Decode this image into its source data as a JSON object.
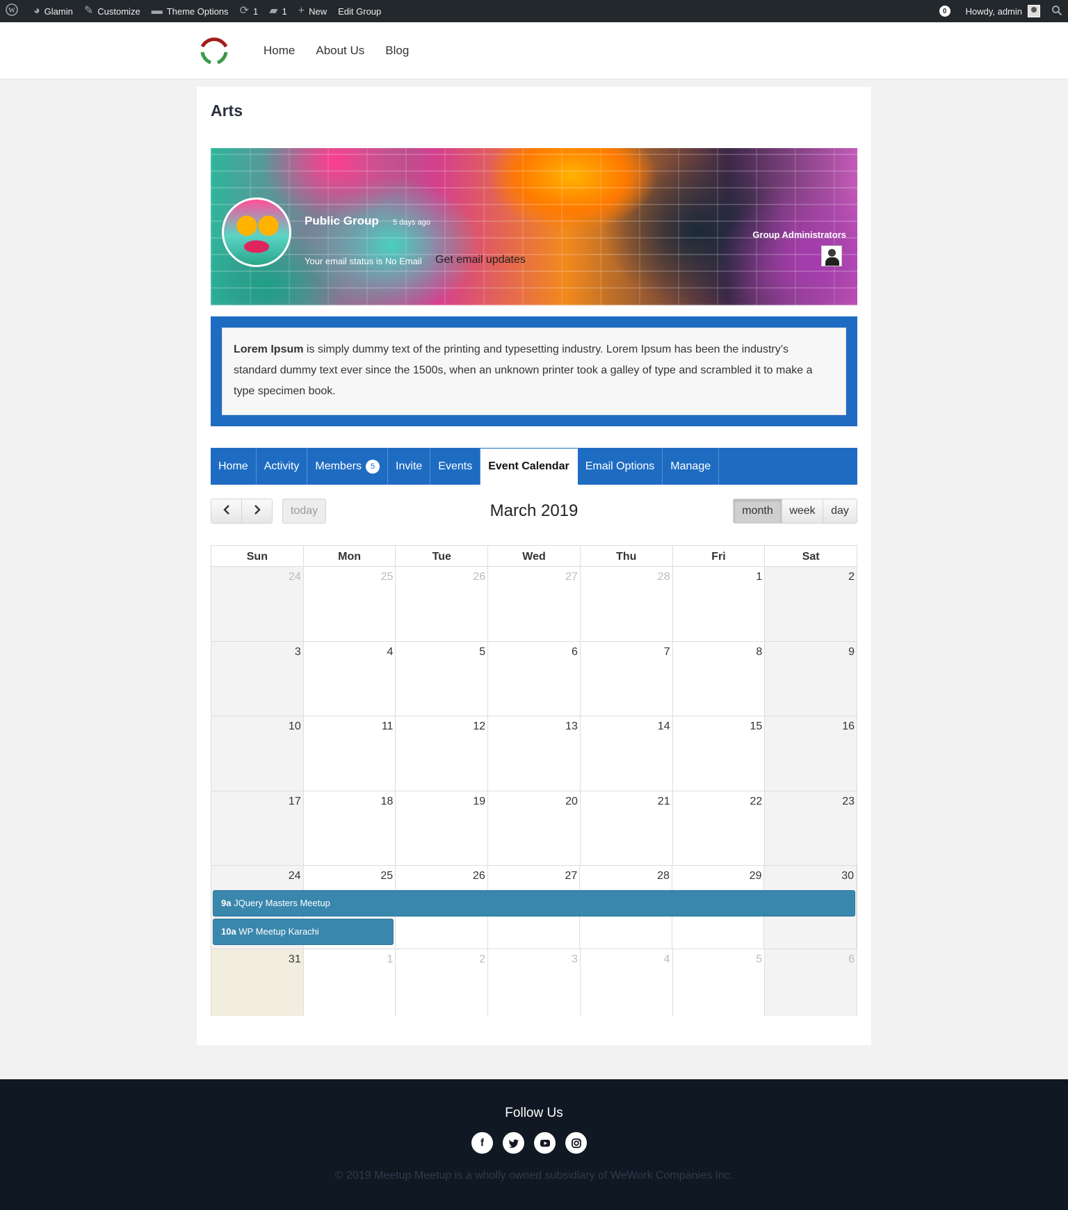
{
  "adminbar": {
    "site_name": "Glamin",
    "customize": "Customize",
    "theme_options": "Theme Options",
    "updates_count": "1",
    "comments_count": "1",
    "new": "New",
    "edit_group": "Edit Group",
    "notifications": "0",
    "howdy": "Howdy, admin"
  },
  "nav": {
    "items": [
      "Home",
      "About Us",
      "Blog"
    ]
  },
  "page": {
    "title": "Arts"
  },
  "group": {
    "type": "Public Group",
    "active": "5 days ago",
    "email_status": "Your email status is No Email",
    "email_button": "Get email updates",
    "admins_label": "Group Administrators",
    "description_bold": "Lorem Ipsum",
    "description_rest": " is simply dummy text of the printing and typesetting industry. Lorem Ipsum has been the industry’s standard dummy text ever since the 1500s, when an unknown printer took a galley of type and scrambled it to make a type specimen book."
  },
  "tabs": {
    "home": "Home",
    "activity": "Activity",
    "members": "Members",
    "members_count": "5",
    "invite": "Invite",
    "events": "Events",
    "event_calendar": "Event Calendar",
    "email_options": "Email Options",
    "manage": "Manage"
  },
  "calendar": {
    "title": "March 2019",
    "today_label": "today",
    "prev_icon": "chevron-left-icon",
    "next_icon": "chevron-right-icon",
    "views": [
      "month",
      "week",
      "day"
    ],
    "active_view": "month",
    "weekdays": [
      "Sun",
      "Mon",
      "Tue",
      "Wed",
      "Thu",
      "Fri",
      "Sat"
    ],
    "weeks": [
      [
        "24",
        "25",
        "26",
        "27",
        "28",
        "1",
        "2"
      ],
      [
        "3",
        "4",
        "5",
        "6",
        "7",
        "8",
        "9"
      ],
      [
        "10",
        "11",
        "12",
        "13",
        "14",
        "15",
        "16"
      ],
      [
        "17",
        "18",
        "19",
        "20",
        "21",
        "22",
        "23"
      ],
      [
        "24",
        "25",
        "26",
        "27",
        "28",
        "29",
        "30"
      ],
      [
        "31",
        "1",
        "2",
        "3",
        "4",
        "5",
        "6"
      ]
    ],
    "events": [
      {
        "time": "9a",
        "title": "JQuery Masters Meetup"
      },
      {
        "time": "10a",
        "title": "WP Meetup Karachi"
      }
    ]
  },
  "footer": {
    "follow": "Follow Us",
    "social": [
      "facebook-icon",
      "twitter-icon",
      "youtube-icon",
      "instagram-icon"
    ],
    "copyright": "© 2019 Meetup Meetup is a wholly owned subsidiary of WeWork Companies Inc."
  },
  "colors": {
    "primary": "#1e6cc2",
    "event": "#3a87ad",
    "adminbar": "#23282d",
    "footer": "#0f1823"
  }
}
